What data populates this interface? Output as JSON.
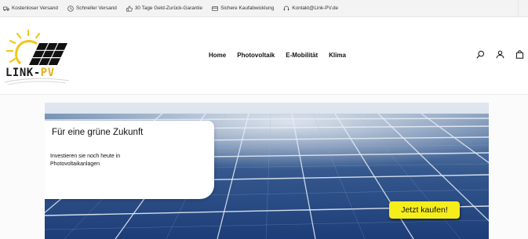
{
  "topbar": {
    "items": [
      {
        "label": "Kostenloser Versand",
        "icon": "truck-icon"
      },
      {
        "label": "Schneller Versand",
        "icon": "clock-icon"
      },
      {
        "label": "30 Tage Geld-Zurück-Garantie",
        "icon": "thumbs-up-icon"
      },
      {
        "label": "Sichere Kaufabwicklung",
        "icon": "credit-card-icon"
      },
      {
        "label": "Kontakt@Link-PV.de",
        "icon": "headset-icon"
      }
    ]
  },
  "brand": {
    "logo_text_prefix": "LINK-",
    "logo_text_suffix": "PV",
    "accent_color": "#e2b21a"
  },
  "nav": {
    "items": [
      "Home",
      "Photovoltaik",
      "E-Mobilität",
      "Klima"
    ]
  },
  "header_icons": [
    "search-icon",
    "user-icon",
    "shopping-bag-icon"
  ],
  "hero": {
    "title": "Für eine grüne Zukunft",
    "description": "Investieren sie noch heute in Photovoltaikanlagen",
    "cta_label": "Jetzt kaufen!",
    "cta_color": "#f5ee1a"
  }
}
